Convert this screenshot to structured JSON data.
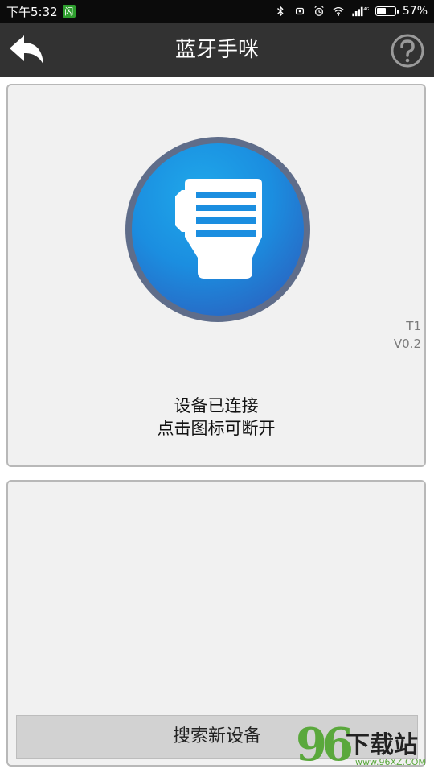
{
  "status_bar": {
    "time": "下午5:32",
    "app_icon_text": "闪",
    "network": "4G",
    "battery_percent": "57%",
    "battery_level": 0.57
  },
  "title_bar": {
    "title": "蓝牙手咪"
  },
  "device_panel": {
    "icon": "walkie-talkie-mic-icon",
    "model": "T1",
    "version": "V0.2",
    "status_line1": "设备已连接",
    "status_line2": "点击图标可断开"
  },
  "search_panel": {
    "button_label": "搜索新设备"
  },
  "watermark": {
    "logo_number": "96",
    "logo_text": "下载站",
    "url": "www.96XZ.COM"
  },
  "colors": {
    "title_bar_bg": "#323232",
    "status_bar_bg": "#0b0b0b",
    "icon_blue": "#1b8ee0",
    "panel_bg": "#f1f1f1",
    "button_bg": "#d2d2d2",
    "watermark_green": "#5aa83c"
  }
}
